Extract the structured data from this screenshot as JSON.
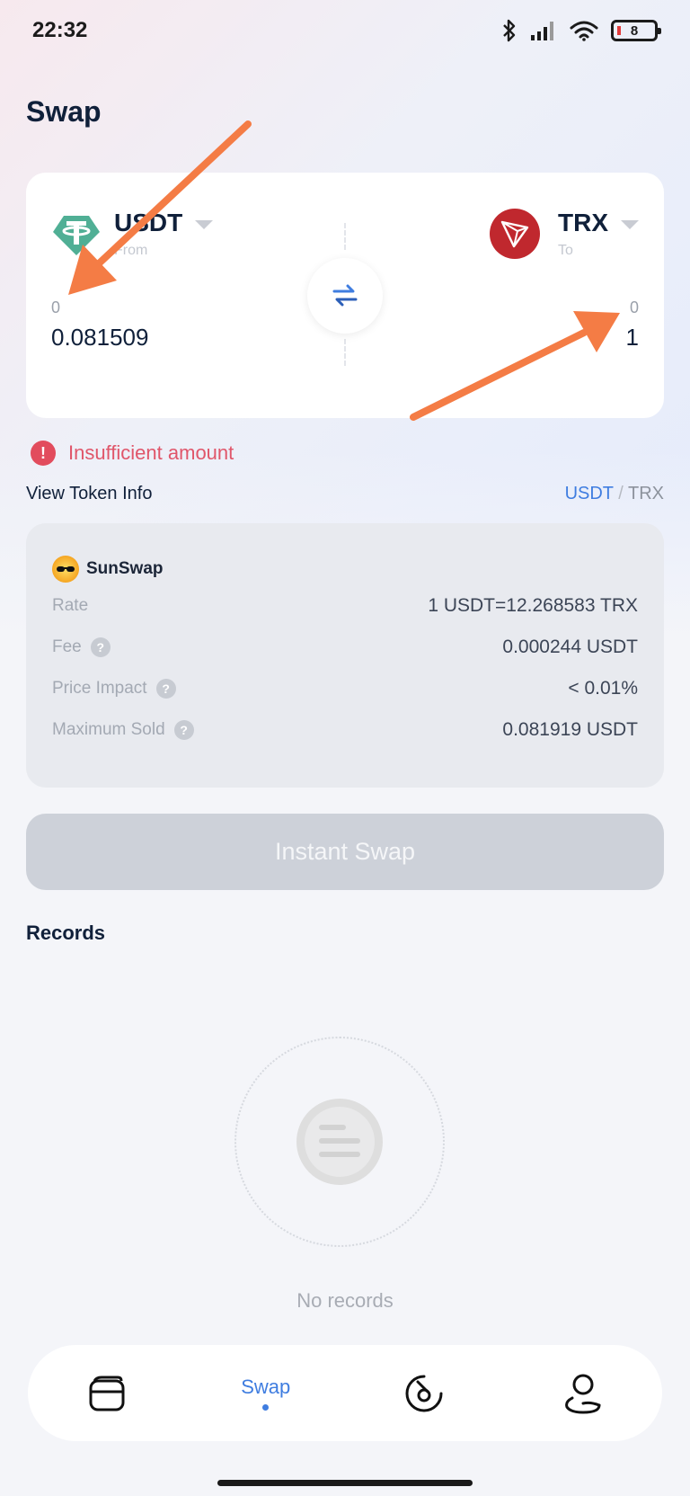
{
  "status_bar": {
    "time": "22:32",
    "battery": "8"
  },
  "page": {
    "title": "Swap"
  },
  "swap": {
    "from": {
      "token": "USDT",
      "sub_label": "From",
      "balance": "0",
      "amount": "0.081509"
    },
    "to": {
      "token": "TRX",
      "sub_label": "To",
      "balance": "0",
      "amount": "1"
    }
  },
  "error": {
    "text": "Insufficient amount"
  },
  "token_info": {
    "link_label": "View Token Info",
    "pair_from": "USDT",
    "pair_sep": "/",
    "pair_to": "TRX"
  },
  "details": {
    "provider": "SunSwap",
    "rows": [
      {
        "label": "Rate",
        "value": "1 USDT=12.268583 TRX",
        "help": false
      },
      {
        "label": "Fee",
        "value": "0.000244 USDT",
        "help": true
      },
      {
        "label": "Price Impact",
        "value": "< 0.01%",
        "help": true
      },
      {
        "label": "Maximum Sold",
        "value": "0.081919 USDT",
        "help": true
      }
    ]
  },
  "actions": {
    "swap_button": "Instant Swap"
  },
  "records": {
    "title": "Records",
    "empty_text": "No records"
  },
  "nav": {
    "active_label": "Swap",
    "items": [
      "wallet-icon",
      "swap",
      "discover-icon",
      "profile-icon"
    ]
  },
  "colors": {
    "accent": "#3f7de0",
    "error": "#e0566a",
    "usdt": "#50af95",
    "trx": "#c0282e",
    "annotation": "#f47c45"
  }
}
